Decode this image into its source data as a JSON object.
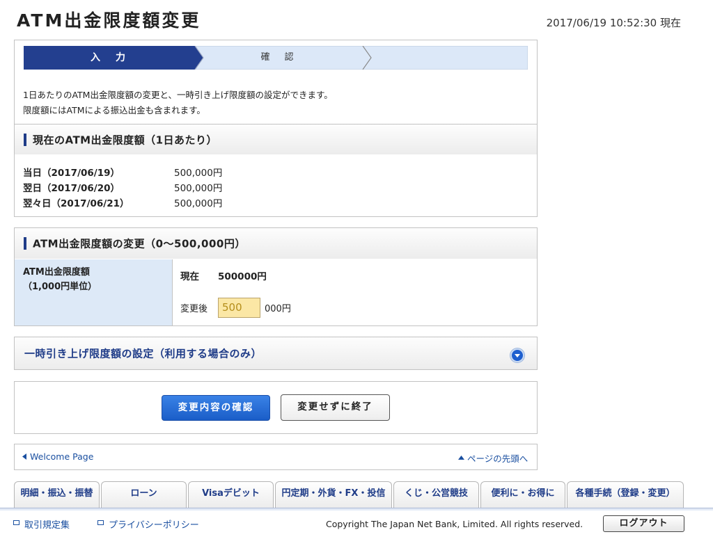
{
  "page": {
    "title": "ATM出金限度額変更",
    "timestamp": "2017/06/19 10:52:30 現在"
  },
  "steps": {
    "active_label": "入　力",
    "next_label": "確　認"
  },
  "intro": {
    "line1": "1日あたりのATM出金限度額の変更と、一時引き上げ限度額の設定ができます。",
    "line2": "限度額にはATMによる振込出金も含まれます。"
  },
  "current_limits": {
    "heading": "現在のATM出金限度額（1日あたり）",
    "rows": [
      {
        "label": "当日（2017/06/19）",
        "value": "500,000円"
      },
      {
        "label": "翌日（2017/06/20）",
        "value": "500,000円"
      },
      {
        "label": "翌々日（2017/06/21）",
        "value": "500,000円"
      }
    ]
  },
  "change": {
    "heading": "ATM出金限度額の変更（0〜500,000円）",
    "field_label_line1": "ATM出金限度額",
    "field_label_line2": "（1,000円単位）",
    "current_label": "現在",
    "current_value": "500000円",
    "after_label": "変更後",
    "input_value": "500",
    "unit": "000円"
  },
  "temporary": {
    "heading": "一時引き上げ限度額の設定（利用する場合のみ）"
  },
  "actions": {
    "confirm_label": "変更内容の確認",
    "cancel_label": "変更せずに終了"
  },
  "nav": {
    "welcome_link": "Welcome Page",
    "top_link": "ページの先頭へ"
  },
  "tabs": [
    "明細・振込・振替",
    "ローン",
    "Visaデビット",
    "円定期・外貨・FX・投信",
    "くじ・公営競技",
    "便利に・お得に",
    "各種手続（登録・変更）"
  ],
  "footer": {
    "terms_link": "取引規定集",
    "privacy_link": "プライバシーポリシー",
    "copyright": "Copyright The Japan Net Bank, Limited. All rights reserved.",
    "logout_label": "ログアウト"
  },
  "colors": {
    "brand_navy": "#233f8f",
    "accent_blue": "#1a5dc8",
    "label_cell_bg": "#dde9f7",
    "input_bg": "#fbe7a5"
  }
}
